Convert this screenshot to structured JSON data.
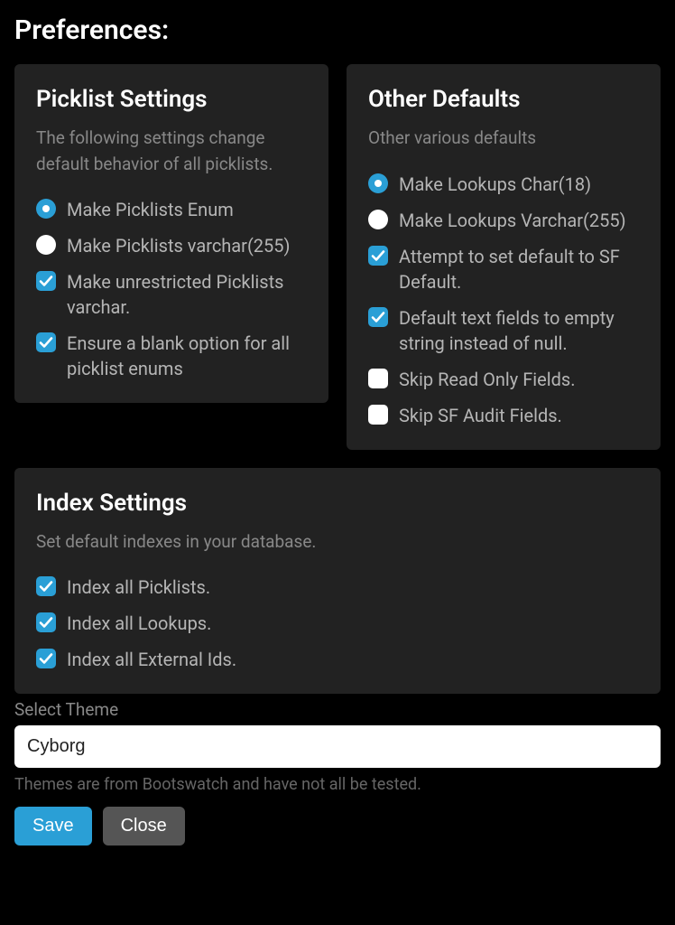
{
  "heading": "Preferences:",
  "picklist": {
    "title": "Picklist Settings",
    "desc": "The following settings change default behavior of all picklists.",
    "options": [
      {
        "type": "radio",
        "checked": true,
        "label": "Make Picklists Enum"
      },
      {
        "type": "radio",
        "checked": false,
        "label": "Make Picklists varchar(255)"
      },
      {
        "type": "checkbox",
        "checked": true,
        "label": "Make unrestricted Picklists varchar."
      },
      {
        "type": "checkbox",
        "checked": true,
        "label": "Ensure a blank option for all picklist enums"
      }
    ]
  },
  "other": {
    "title": "Other Defaults",
    "desc": "Other various defaults",
    "options": [
      {
        "type": "radio",
        "checked": true,
        "label": "Make Lookups Char(18)"
      },
      {
        "type": "radio",
        "checked": false,
        "label": "Make Lookups Varchar(255)"
      },
      {
        "type": "checkbox",
        "checked": true,
        "label": "Attempt to set default to SF Default."
      },
      {
        "type": "checkbox",
        "checked": true,
        "label": "Default text fields to empty string instead of null."
      },
      {
        "type": "checkbox",
        "checked": false,
        "label": "Skip Read Only Fields."
      },
      {
        "type": "checkbox",
        "checked": false,
        "label": "Skip SF Audit Fields."
      }
    ]
  },
  "index": {
    "title": "Index Settings",
    "desc": "Set default indexes in your database.",
    "options": [
      {
        "type": "checkbox",
        "checked": true,
        "label": "Index all Picklists."
      },
      {
        "type": "checkbox",
        "checked": true,
        "label": "Index all Lookups."
      },
      {
        "type": "checkbox",
        "checked": true,
        "label": "Index all External Ids."
      }
    ]
  },
  "theme": {
    "label": "Select Theme",
    "value": "Cyborg",
    "hint": "Themes are from Bootswatch and have not all be tested."
  },
  "buttons": {
    "save": "Save",
    "close": "Close"
  }
}
